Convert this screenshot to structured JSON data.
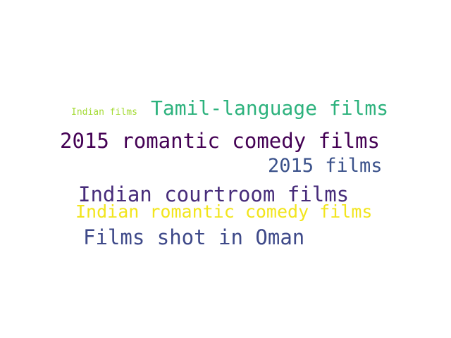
{
  "words": {
    "indian_films": {
      "text": "Indian films",
      "color": "#a5db36"
    },
    "tamil_language_films": {
      "text": "Tamil-language films",
      "color": "#2db27d"
    },
    "romantic_comedy_2015": {
      "text": "2015 romantic comedy films",
      "color": "#440154"
    },
    "films_2015": {
      "text": "2015 films",
      "color": "#3b528b"
    },
    "indian_courtroom_films": {
      "text": "Indian courtroom films",
      "color": "#472c7a"
    },
    "indian_romantic_comedy_films": {
      "text": "Indian romantic comedy films",
      "color": "#f2e51d"
    },
    "films_shot_in_oman": {
      "text": "Films shot in Oman",
      "color": "#3e4989"
    }
  }
}
